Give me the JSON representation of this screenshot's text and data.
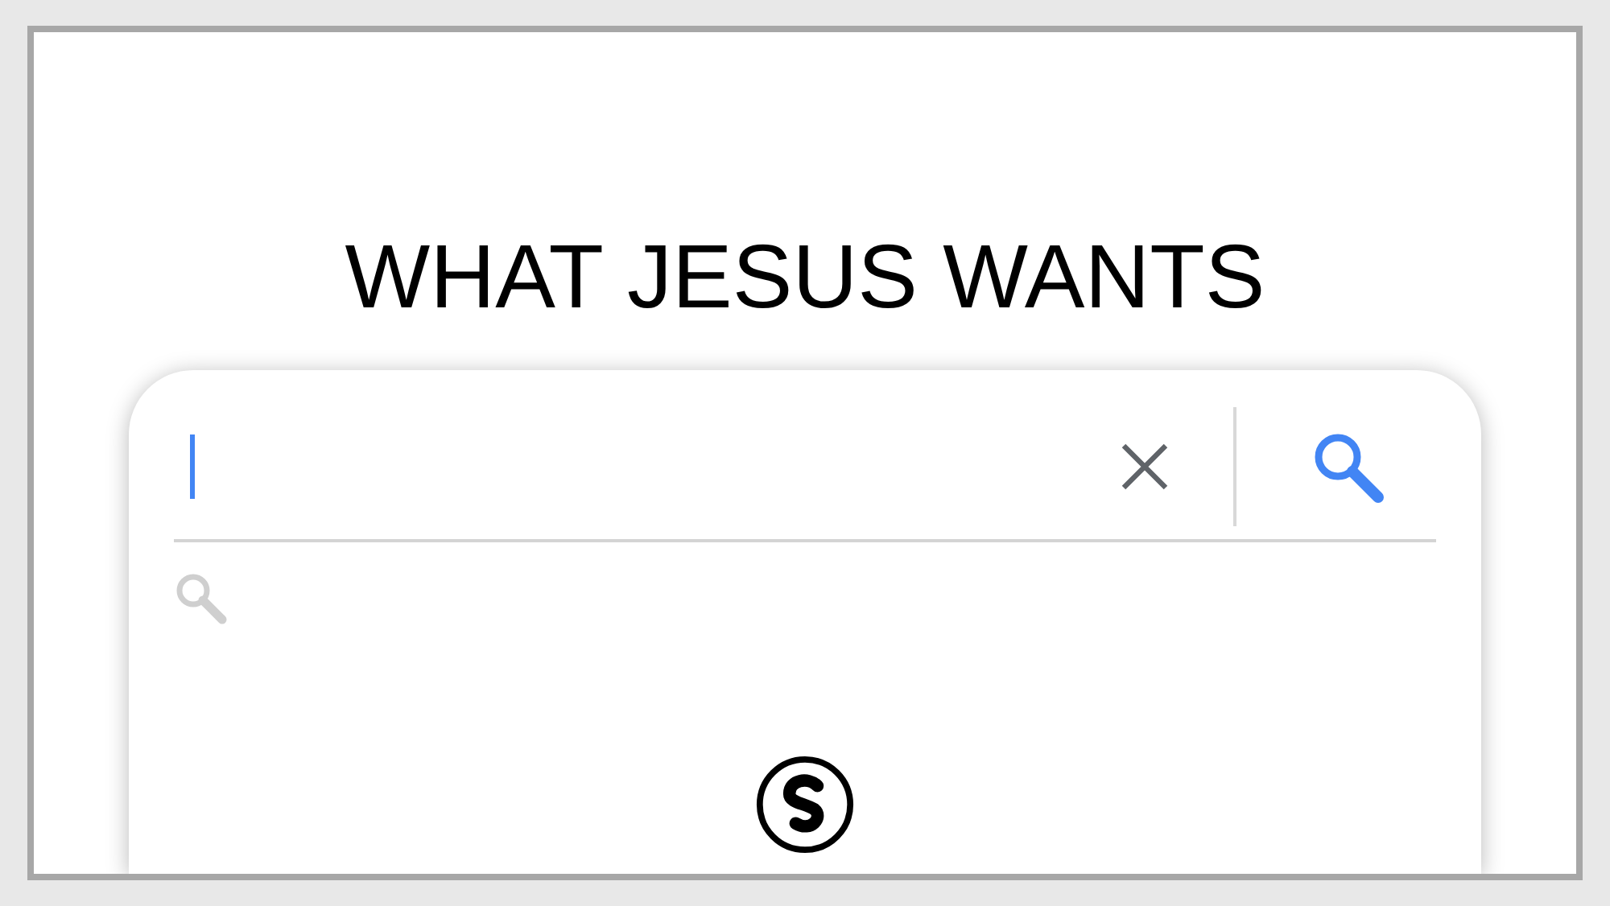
{
  "title": "WHAT JESUS WANTS",
  "search": {
    "focused": true
  }
}
